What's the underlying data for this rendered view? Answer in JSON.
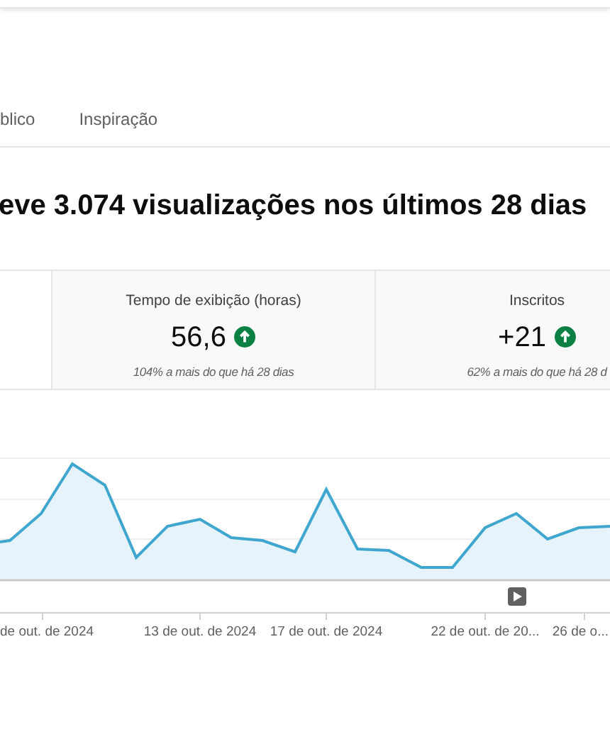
{
  "tabs": [
    {
      "label": "blico",
      "selected": false
    },
    {
      "label": "Inspiração",
      "selected": false
    }
  ],
  "heading": "eve 3.074 visualizações nos últimos 28 dias",
  "metric_cards": [
    {
      "title": "Tempo de exibição (horas)",
      "value": "56,6",
      "increase": true,
      "comparison": "104% a mais do que há 28 dias"
    },
    {
      "title": "Inscritos",
      "value": "+21",
      "increase": true,
      "comparison": "62% a mais do que há 28 d"
    }
  ],
  "chart": {
    "x_labels": [
      "de out. de 2024",
      "13 de out. de 2024",
      "17 de out. de 2024",
      "22 de out. de 20...",
      "26 de o..."
    ]
  }
}
